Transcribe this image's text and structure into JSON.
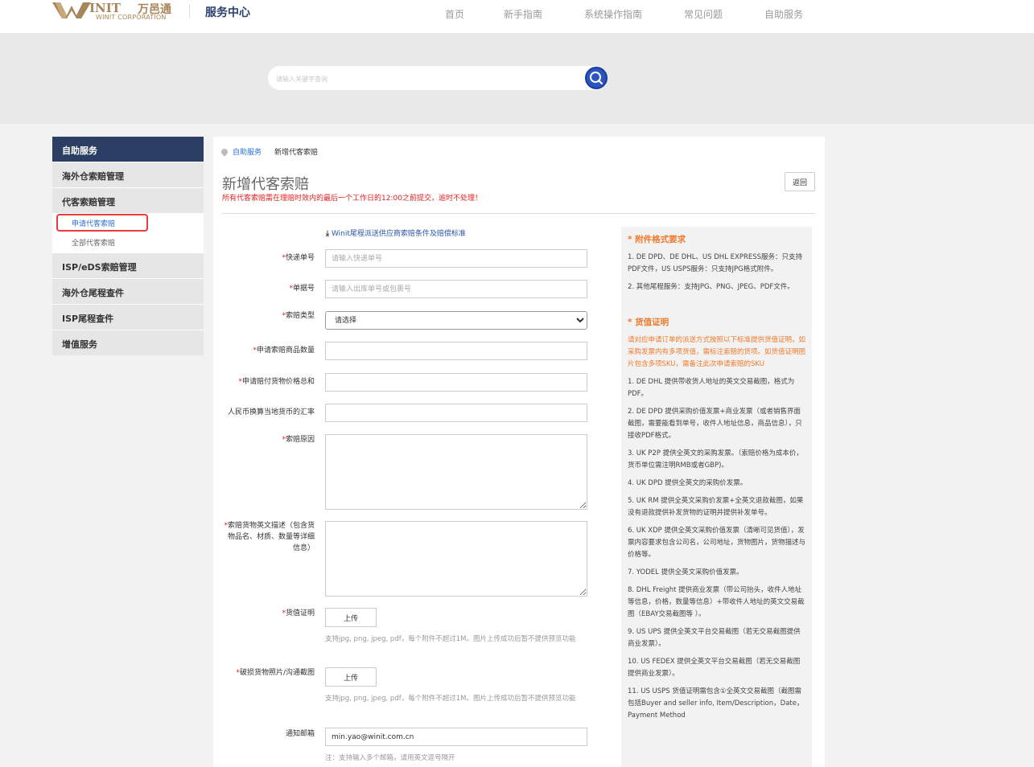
{
  "header": {
    "logo_text": "INIT",
    "logo_cn": "万邑通",
    "logo_sub": "WINIT CORPORATION",
    "site_title": "服务中心",
    "nav": [
      "首页",
      "新手指南",
      "系统操作指南",
      "常见问题",
      "自助服务"
    ]
  },
  "search": {
    "placeholder": "请输入关键字查询"
  },
  "sidebar": {
    "head": "自助服务",
    "items": [
      {
        "label": "海外仓索赔管理"
      },
      {
        "label": "代客索赔管理"
      },
      {
        "label": "ISP/eDS索赔管理"
      },
      {
        "label": "海外仓尾程查件"
      },
      {
        "label": "ISP尾程查件"
      },
      {
        "label": "增值服务"
      }
    ],
    "sub_items": [
      {
        "label": "申请代客索赔"
      },
      {
        "label": "全部代客索赔"
      }
    ]
  },
  "breadcrumb": {
    "root": "自助服务",
    "current": "新增代客索赔"
  },
  "page": {
    "title": "新增代客索赔",
    "notice": "所有代客索赔需在理赔时效内的最后一个工作日的12:00之前提交，逾时不处理！",
    "back": "返回",
    "download": "Winit尾程派送供应商索赔条件及赔偿标准"
  },
  "form": {
    "express_no": {
      "label": "快递单号",
      "placeholder": "请输入快递单号"
    },
    "doc_no": {
      "label": "单据号",
      "placeholder": "请输入出库单号或包裹号"
    },
    "claim_type": {
      "label": "索赔类型",
      "selected": "请选择"
    },
    "qty": {
      "label": "申请索赔商品数量"
    },
    "total": {
      "label": "申请赔付货物价格总和"
    },
    "rate": {
      "label": "人民币换算当地货币的汇率"
    },
    "reason": {
      "label": "索赔原因"
    },
    "desc": {
      "label": "索赔货物英文描述（包含货物品名、材质、数量等详细信息）"
    },
    "value_proof": {
      "label": "货值证明",
      "button": "上传",
      "hint": "支持jpg, png, jpeg, pdf，每个附件不超过1M。图片上传成功后暂不提供预览功能"
    },
    "damage_photo": {
      "label": "破损货物照片/沟通截图",
      "button": "上传",
      "hint": "支持jpg, png, jpeg, pdf，每个附件不超过1M。图片上传成功后暂不提供预览功能"
    },
    "email": {
      "label": "通知邮箱",
      "value": "min.yao@winit.com.cn",
      "note": "注：支持输入多个邮箱，请用英文逗号隔开"
    }
  },
  "aside": {
    "h1": "* 附件格式要求",
    "p1": "1. DE DPD、DE DHL、US DHL EXPRESS服务：只支持PDF文件，US USPS服务：只支持JPG格式附件。",
    "p2": "2. 其他尾程服务：支持JPG、PNG、JPEG、PDF文件。",
    "h2": "* 货值证明",
    "warn": "请对应申请订单的派送方式按照以下标准提供货值证明，如采购发票内有多项货值，需标注索赔的货项。如货值证明图片包含多项SKU，需备注此次申请索赔的SKU",
    "items": [
      "1. DE DHL 提供带收货人地址的英文交易截图，格式为PDF。",
      "2. DE DPD 提供采购价值发票+商业发票（或者销售界面截图，需要能看到单号，收件人地址信息，商品信息），只接收PDF格式。",
      "3. UK P2P 提供全英文的采购发票。（索赔价格为成本价，货币单位需注明RMB或者GBP)。",
      "4. UK DPD 提供全英文的采购价发票。",
      "5. UK RM 提供全英文采购价发票+全英文退款截图，如果没有退款提供补发货物的证明并提供补发单号。",
      "6. UK XDP 提供全英文采购价值发票（清晰可见货值），发票内容要求包含公司名，公司地址，货物图片，货物描述与价格等。",
      "7. YODEL 提供全英文采购价值发票。",
      "8. DHL Freight 提供商业发票（带公司抬头，收件人地址等信息，价格，数量等信息）+带收件人地址的英文交易截图（EBAY交易截图等 ）。",
      "9. US UPS 提供全英文平台交易截图（若无交易截图提供商业发票）。",
      "10. US FEDEX 提供全英文平台交易截图（若无交易截图提供商业发票）。",
      "11. US USPS 货值证明需包含①全英文交易截图（截图需包括Buyer and seller info, Item/Description，Date，Payment Method"
    ]
  },
  "colors": {
    "brand": "#a9865a",
    "nav_dark": "#2c3e63",
    "link": "#2b6fd6",
    "alert": "#e02020",
    "accent_orange": "#f07a2a",
    "search_btn": "#2b56c2"
  }
}
